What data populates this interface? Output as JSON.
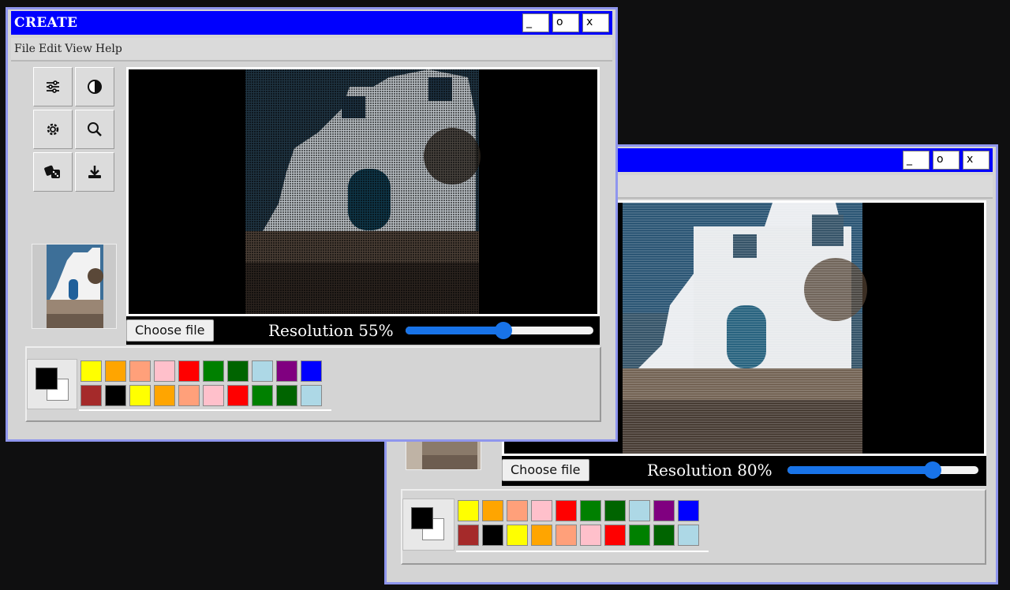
{
  "colors": {
    "titlebar": "#0000fe",
    "window_border": "#8f96ee",
    "accent": "#1873e8"
  },
  "main_window": {
    "title": "CREATE",
    "minimize_label": "_",
    "maximize_label": "o",
    "close_label": "x",
    "menu": [
      "File",
      "Edit",
      "View",
      "Help"
    ],
    "tools": [
      "sliders-icon",
      "contrast-icon",
      "gear-icon",
      "search-icon",
      "dice-icon",
      "download-icon"
    ],
    "choose_file_label": "Choose file",
    "resolution_label": "Resolution 55%",
    "resolution_value": 55
  },
  "second_window": {
    "minimize_label": "_",
    "maximize_label": "o",
    "close_label": "x",
    "choose_file_label": "Choose file",
    "resolution_label": "Resolution 80%",
    "resolution_value": 80
  },
  "palette": {
    "foreground": "#000000",
    "background": "#ffffff",
    "row1": [
      "#ffff00",
      "#ffa500",
      "#ffa07a",
      "#ffc0cb",
      "#ff0000",
      "#008000",
      "#006400",
      "#add8e6",
      "#800080",
      "#0000ff"
    ],
    "row2": [
      "#a52a2a",
      "#000000",
      "#ffff00",
      "#ffa500",
      "#ffa07a",
      "#ffc0cb",
      "#ff0000",
      "#008000",
      "#006400",
      "#add8e6"
    ]
  }
}
